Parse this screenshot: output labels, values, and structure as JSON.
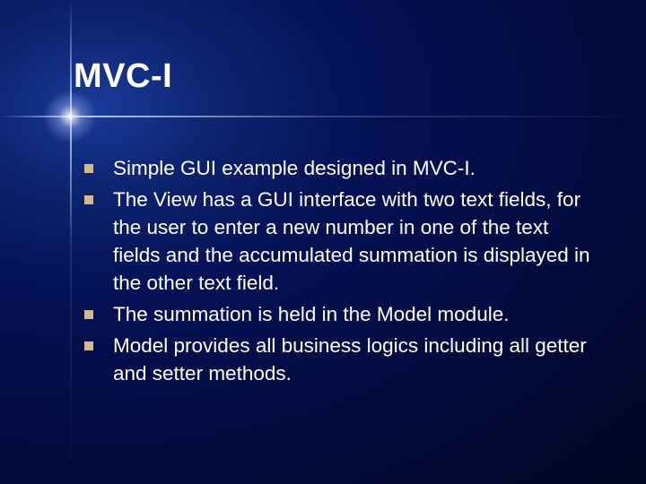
{
  "slide": {
    "title": "MVC-I",
    "bullets": [
      "Simple GUI example designed in MVC-I.",
      "The View has a GUI interface with two text fields, for the user to enter a new number in one of the text fields and the accumulated summation is displayed in the other text field.",
      "The summation is held in the Model module.",
      "Model provides all business logics including all getter and setter methods."
    ]
  }
}
